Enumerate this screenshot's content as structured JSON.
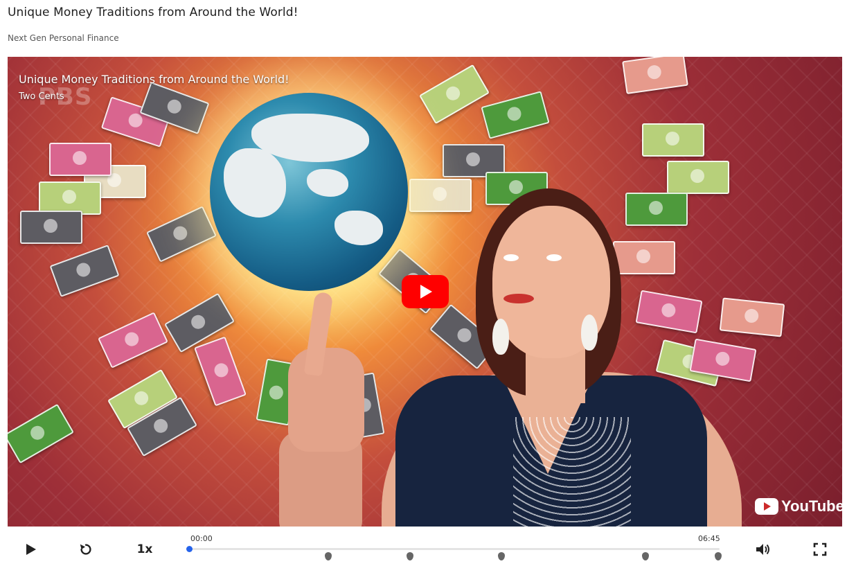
{
  "page": {
    "title": "Unique Money Traditions from Around the World!",
    "subtitle": "Next Gen Personal Finance"
  },
  "video": {
    "title": "Unique Money Traditions from Around the World!",
    "channel": "Two Cents",
    "watermark": "PBS",
    "platform_logo": "YouTube",
    "play_overlay_icon": "play-icon"
  },
  "controls": {
    "play_icon": "play-icon",
    "replay_icon": "replay-icon",
    "speed": "1x",
    "current_time": "00:00",
    "duration": "06:45",
    "progress_fraction": 0.0,
    "chapter_markers_fraction": [
      0.263,
      0.417,
      0.589,
      0.86,
      0.997
    ],
    "volume_icon": "volume-icon",
    "fullscreen_icon": "fullscreen-icon",
    "accent_color": "#2563eb"
  }
}
